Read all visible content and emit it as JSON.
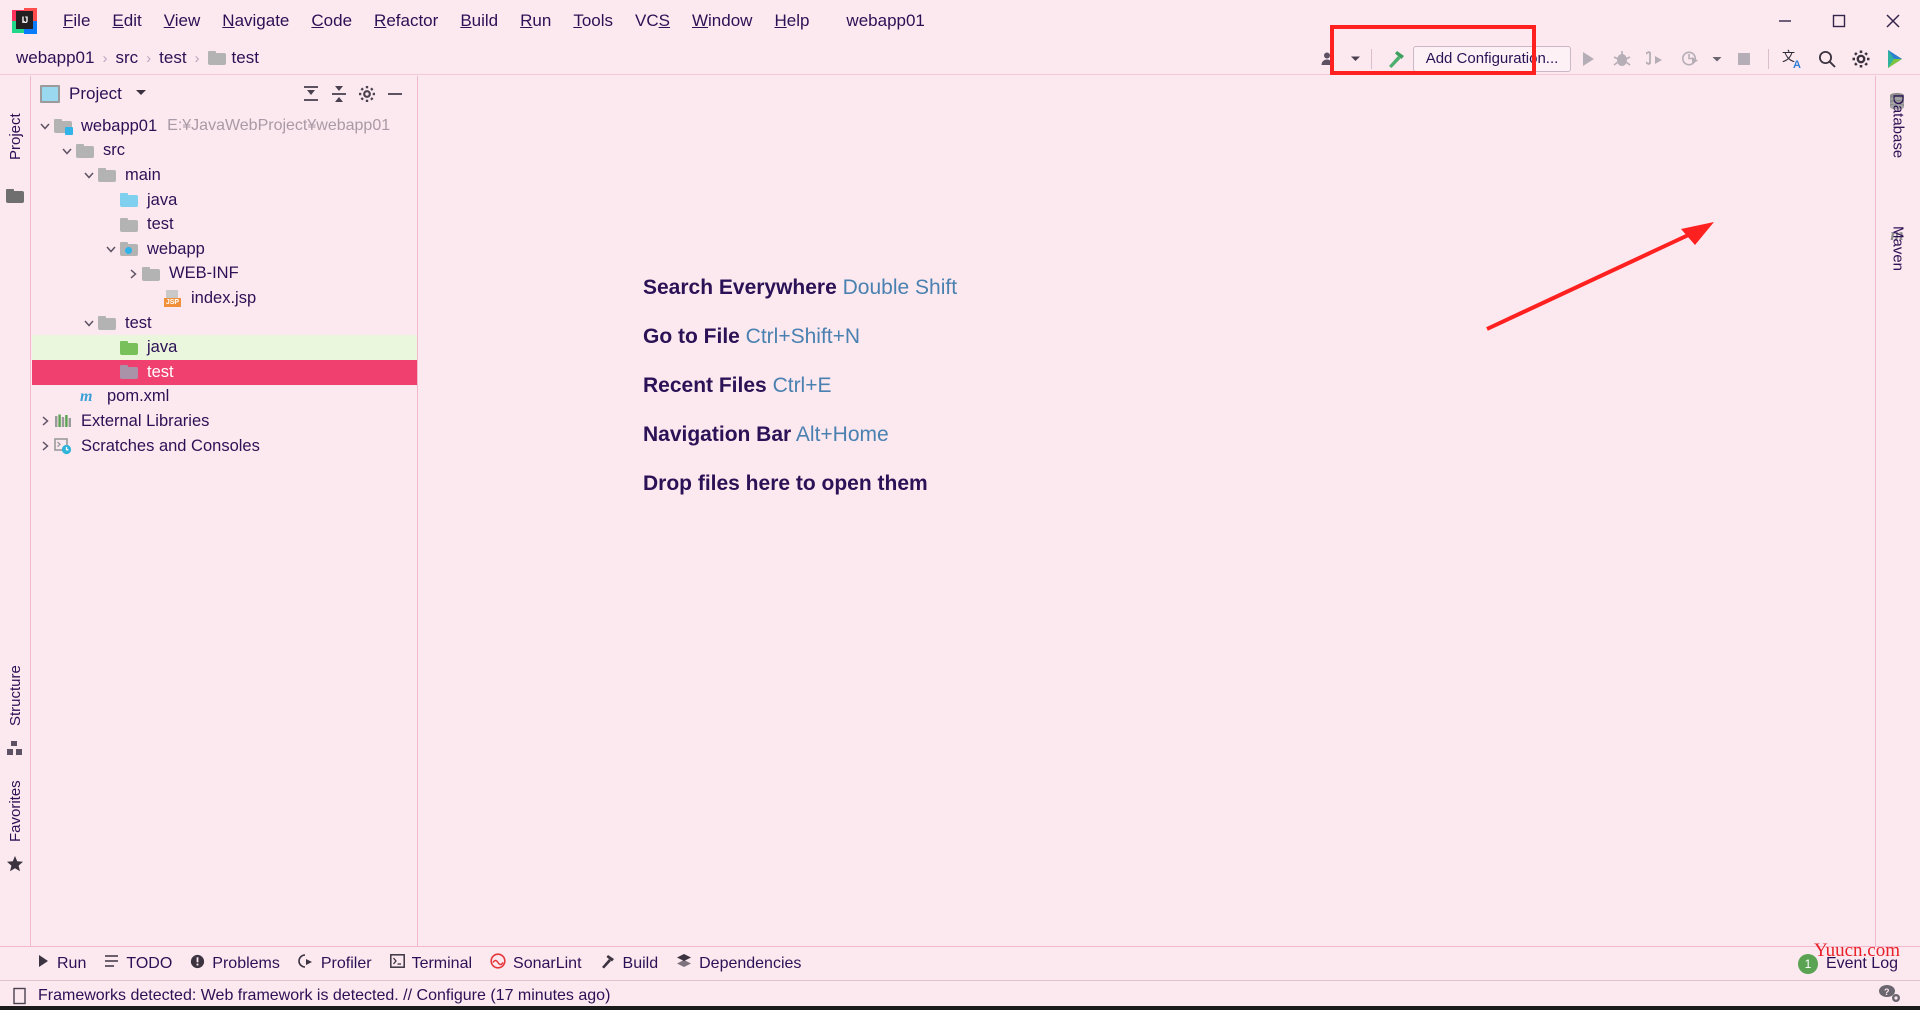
{
  "window": {
    "title": "webapp01",
    "logo_text": "IJ",
    "controls": [
      "minimize",
      "maximize",
      "close"
    ]
  },
  "menubar": {
    "items": [
      {
        "label": "File",
        "mnemonic": "F"
      },
      {
        "label": "Edit",
        "mnemonic": "E"
      },
      {
        "label": "View",
        "mnemonic": "V"
      },
      {
        "label": "Navigate",
        "mnemonic": "N"
      },
      {
        "label": "Code",
        "mnemonic": "C"
      },
      {
        "label": "Refactor",
        "mnemonic": "R"
      },
      {
        "label": "Build",
        "mnemonic": "B"
      },
      {
        "label": "Run",
        "mnemonic": "R"
      },
      {
        "label": "Tools",
        "mnemonic": "T"
      },
      {
        "label": "VCS",
        "mnemonic": "S"
      },
      {
        "label": "Window",
        "mnemonic": "W"
      },
      {
        "label": "Help",
        "mnemonic": "H"
      }
    ]
  },
  "navbar": {
    "breadcrumbs": [
      "webapp01",
      "src",
      "test",
      "test"
    ],
    "separator": "›",
    "add_configuration_label": "Add Configuration...",
    "icons": [
      "user-account-icon",
      "chevron-down-icon",
      "build-hammer-icon",
      "run-icon",
      "debug-icon",
      "run-with-coverage-icon",
      "profile-icon",
      "chevron-down-icon",
      "stop-icon",
      "translate-icon",
      "search-icon",
      "settings-gear-icon",
      "app-launcher-icon"
    ]
  },
  "left_strip": {
    "tabs": [
      "Project",
      "Structure",
      "Favorites"
    ]
  },
  "project_panel": {
    "title": "Project",
    "actions": [
      "expand-all-icon",
      "collapse-all-icon",
      "settings-gear-icon",
      "hide-icon"
    ],
    "tree": [
      {
        "label": "webapp01",
        "subpath": "E:¥JavaWebProject¥webapp01",
        "depth": 0,
        "twisty": "expanded",
        "icon": "module-folder-icon",
        "color": "#b3b3b3",
        "state": "normal"
      },
      {
        "label": "src",
        "subpath": "",
        "depth": 1,
        "twisty": "expanded",
        "icon": "folder-icon",
        "color": "#b3b3b3",
        "state": "normal"
      },
      {
        "label": "main",
        "subpath": "",
        "depth": 2,
        "twisty": "expanded",
        "icon": "folder-icon",
        "color": "#b3b3b3",
        "state": "normal"
      },
      {
        "label": "java",
        "subpath": "",
        "depth": 3,
        "twisty": "none",
        "icon": "sources-folder-icon",
        "color": "#7ed0ee",
        "state": "normal"
      },
      {
        "label": "test",
        "subpath": "",
        "depth": 3,
        "twisty": "none",
        "icon": "folder-icon",
        "color": "#b3b3b3",
        "state": "normal"
      },
      {
        "label": "webapp",
        "subpath": "",
        "depth": 2,
        "twisty": "expanded",
        "icon": "web-folder-icon",
        "color": "#b3b3b3",
        "state": "normal"
      },
      {
        "label": "WEB-INF",
        "subpath": "",
        "depth": 3,
        "twisty": "collapsed",
        "icon": "folder-icon",
        "color": "#b3b3b3",
        "state": "normal"
      },
      {
        "label": "index.jsp",
        "subpath": "",
        "depth": 4,
        "twisty": "none",
        "icon": "jsp-file-icon",
        "color": "#f0903a",
        "state": "normal"
      },
      {
        "label": "test",
        "subpath": "",
        "depth": 1,
        "twisty": "expanded",
        "icon": "folder-icon",
        "color": "#b3b3b3",
        "state": "normal"
      },
      {
        "label": "java",
        "subpath": "",
        "depth": 2,
        "twisty": "none",
        "icon": "test-sources-folder-icon",
        "color": "#77c05a",
        "state": "highlight-green"
      },
      {
        "label": "test",
        "subpath": "",
        "depth": 2,
        "twisty": "none",
        "icon": "folder-icon",
        "color": "#a893a8",
        "state": "selected"
      },
      {
        "label": "pom.xml",
        "subpath": "",
        "depth": 1,
        "twisty": "none",
        "icon": "maven-file-icon",
        "color": "#3aa0d8",
        "state": "normal"
      },
      {
        "label": "External Libraries",
        "subpath": "",
        "depth": 0,
        "twisty": "collapsed",
        "icon": "libraries-icon",
        "color": "#5aa352",
        "state": "normal"
      },
      {
        "label": "Scratches and Consoles",
        "subpath": "",
        "depth": 0,
        "twisty": "collapsed",
        "icon": "scratches-icon",
        "color": "#2fb3d9",
        "state": "normal"
      }
    ]
  },
  "editor": {
    "welcome_lines": [
      {
        "action": "Search Everywhere",
        "shortcut": "Double Shift"
      },
      {
        "action": "Go to File",
        "shortcut": "Ctrl+Shift+N"
      },
      {
        "action": "Recent Files",
        "shortcut": "Ctrl+E"
      },
      {
        "action": "Navigation Bar",
        "shortcut": "Alt+Home"
      }
    ],
    "drop_hint": "Drop files here to open them"
  },
  "right_strip": {
    "tabs": [
      {
        "label": "Database",
        "icon": "database-icon"
      },
      {
        "label": "Maven",
        "icon": "maven-icon"
      }
    ]
  },
  "bottom_toolbar": {
    "items": [
      {
        "label": "Run",
        "icon": "run-icon"
      },
      {
        "label": "TODO",
        "icon": "todo-list-icon"
      },
      {
        "label": "Problems",
        "icon": "problems-icon"
      },
      {
        "label": "Profiler",
        "icon": "profiler-icon"
      },
      {
        "label": "Terminal",
        "icon": "terminal-icon"
      },
      {
        "label": "SonarLint",
        "icon": "sonarlint-icon"
      },
      {
        "label": "Build",
        "icon": "build-hammer-icon"
      },
      {
        "label": "Dependencies",
        "icon": "dependencies-icon"
      }
    ],
    "event_log_label": "Event Log",
    "event_log_count": "1",
    "watermark": "Yuucn.com"
  },
  "statusbar": {
    "message": "Frameworks detected: Web framework is detected. // Configure (17 minutes ago)",
    "right_icon": "help-settings-icon"
  },
  "annotations": {
    "red_box_target": "add-configuration-button",
    "red_arrow_color": "#ff2020"
  },
  "colors": {
    "background": "#fce8ef",
    "selection_pink": "#ef4070",
    "highlight_green": "#eaf7dc",
    "text": "#2b1155",
    "shortcut_blue": "#4a81b0",
    "annotation_red": "#ff2020",
    "watermark_red": "#e8202a"
  }
}
